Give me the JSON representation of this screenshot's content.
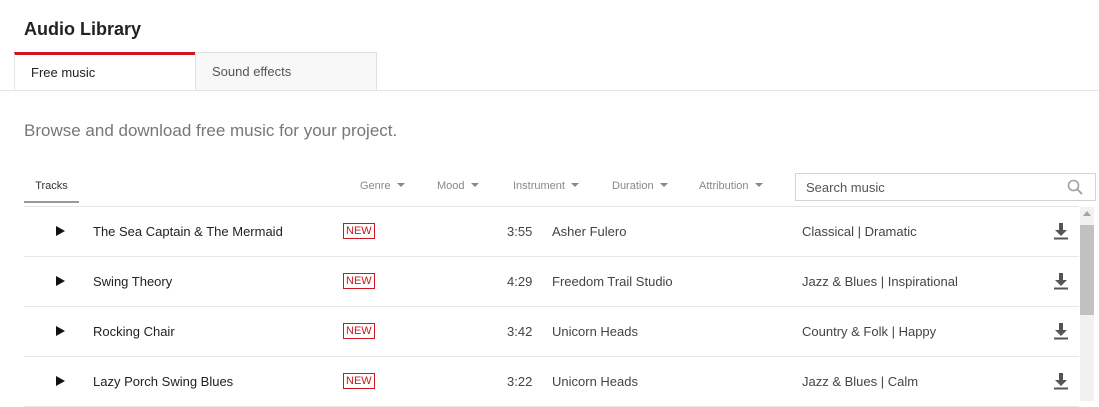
{
  "header": {
    "title": "Audio Library"
  },
  "tabs": [
    {
      "label": "Free music",
      "active": true
    },
    {
      "label": "Sound effects",
      "active": false
    }
  ],
  "subtitle": "Browse and download free music for your project.",
  "toolbar": {
    "tracks_label": "Tracks",
    "filters": [
      "Genre",
      "Mood",
      "Instrument",
      "Duration",
      "Attribution"
    ],
    "search": {
      "placeholder": "Search music",
      "value": "",
      "icon": "search-icon"
    }
  },
  "colors": {
    "accent": "#cc181e"
  },
  "tracks": [
    {
      "title": "The Sea Captain & The Mermaid",
      "badge": "NEW",
      "duration": "3:55",
      "artist": "Asher Fulero",
      "genre_mood": "Classical | Dramatic"
    },
    {
      "title": "Swing Theory",
      "badge": "NEW",
      "duration": "4:29",
      "artist": "Freedom Trail Studio",
      "genre_mood": "Jazz & Blues | Inspirational"
    },
    {
      "title": "Rocking Chair",
      "badge": "NEW",
      "duration": "3:42",
      "artist": "Unicorn Heads",
      "genre_mood": "Country & Folk | Happy"
    },
    {
      "title": "Lazy Porch Swing Blues",
      "badge": "NEW",
      "duration": "3:22",
      "artist": "Unicorn Heads",
      "genre_mood": "Jazz & Blues | Calm"
    }
  ]
}
